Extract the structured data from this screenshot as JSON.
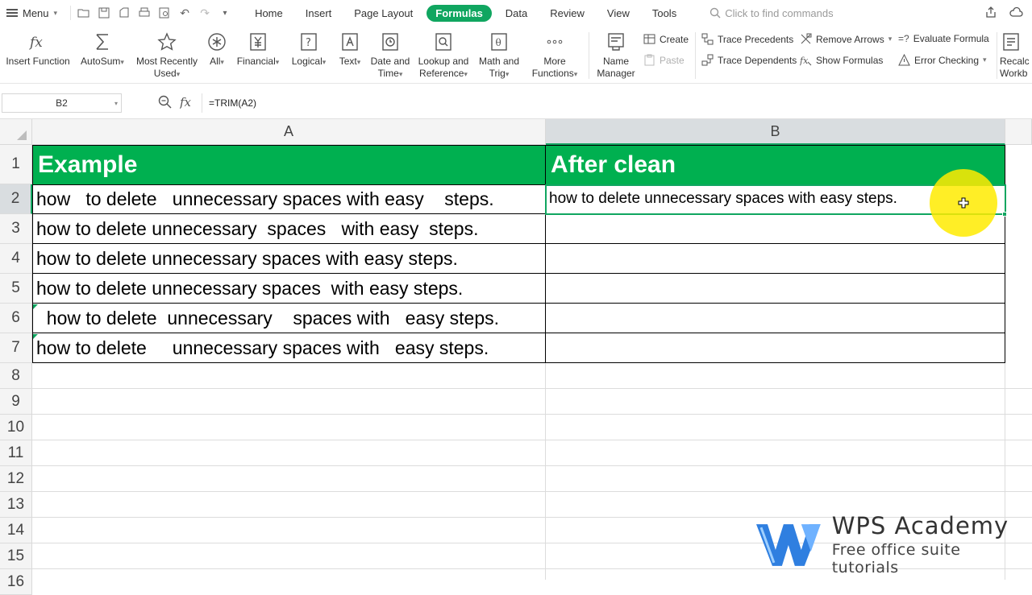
{
  "menu": {
    "label": "Menu"
  },
  "tabs": [
    {
      "label": "Home"
    },
    {
      "label": "Insert"
    },
    {
      "label": "Page Layout"
    },
    {
      "label": "Formulas",
      "active": true
    },
    {
      "label": "Data"
    },
    {
      "label": "Review"
    },
    {
      "label": "View"
    },
    {
      "label": "Tools"
    }
  ],
  "search": {
    "placeholder": "Click to find commands"
  },
  "ribbon": {
    "insert_function": "Insert Function",
    "autosum": "AutoSum",
    "most_recently_used_1": "Most Recently",
    "most_recently_used_2": "Used",
    "all": "All",
    "financial": "Financial",
    "logical": "Logical",
    "text": "Text",
    "date_time_1": "Date and",
    "date_time_2": "Time",
    "lookup_1": "Lookup and",
    "lookup_2": "Reference",
    "math_1": "Math and",
    "math_2": "Trig",
    "more_1": "More",
    "more_2": "Functions",
    "name_manager_1": "Name",
    "name_manager_2": "Manager",
    "create": "Create",
    "paste": "Paste",
    "trace_precedents": "Trace Precedents",
    "trace_dependents": "Trace Dependents",
    "remove_arrows": "Remove Arrows",
    "show_formulas": "Show Formulas",
    "evaluate_formula": "Evaluate Formula",
    "error_checking": "Error Checking",
    "recalc_1": "Recalc",
    "recalc_2": "Workb"
  },
  "formula_bar": {
    "name_box": "B2",
    "formula": "=TRIM(A2)"
  },
  "sheet": {
    "columns": [
      "A",
      "B"
    ],
    "row_numbers": [
      "1",
      "2",
      "3",
      "4",
      "5",
      "6",
      "7",
      "8",
      "9",
      "10",
      "11",
      "12",
      "13",
      "14",
      "15",
      "16"
    ],
    "header": {
      "a": "Example",
      "b": "After clean"
    },
    "rows": [
      {
        "a": "how   to delete   unnecessary spaces with easy    steps.",
        "b": "how to delete unnecessary spaces with easy steps."
      },
      {
        "a": "how to delete unnecessary  spaces   with easy  steps.",
        "b": ""
      },
      {
        "a": "how to delete unnecessary spaces with easy steps.",
        "b": ""
      },
      {
        "a": "how to delete unnecessary spaces  with easy steps.",
        "b": ""
      },
      {
        "a": "  how to delete  unnecessary    spaces with   easy steps.",
        "b": ""
      },
      {
        "a": "how to delete     unnecessary spaces with   easy steps.",
        "b": ""
      }
    ],
    "selected_cell": "B2"
  },
  "watermark": {
    "title": "WPS Academy",
    "subtitle": "Free office suite tutorials"
  },
  "colors": {
    "accent": "#10a660",
    "header_fill": "#00b050"
  }
}
